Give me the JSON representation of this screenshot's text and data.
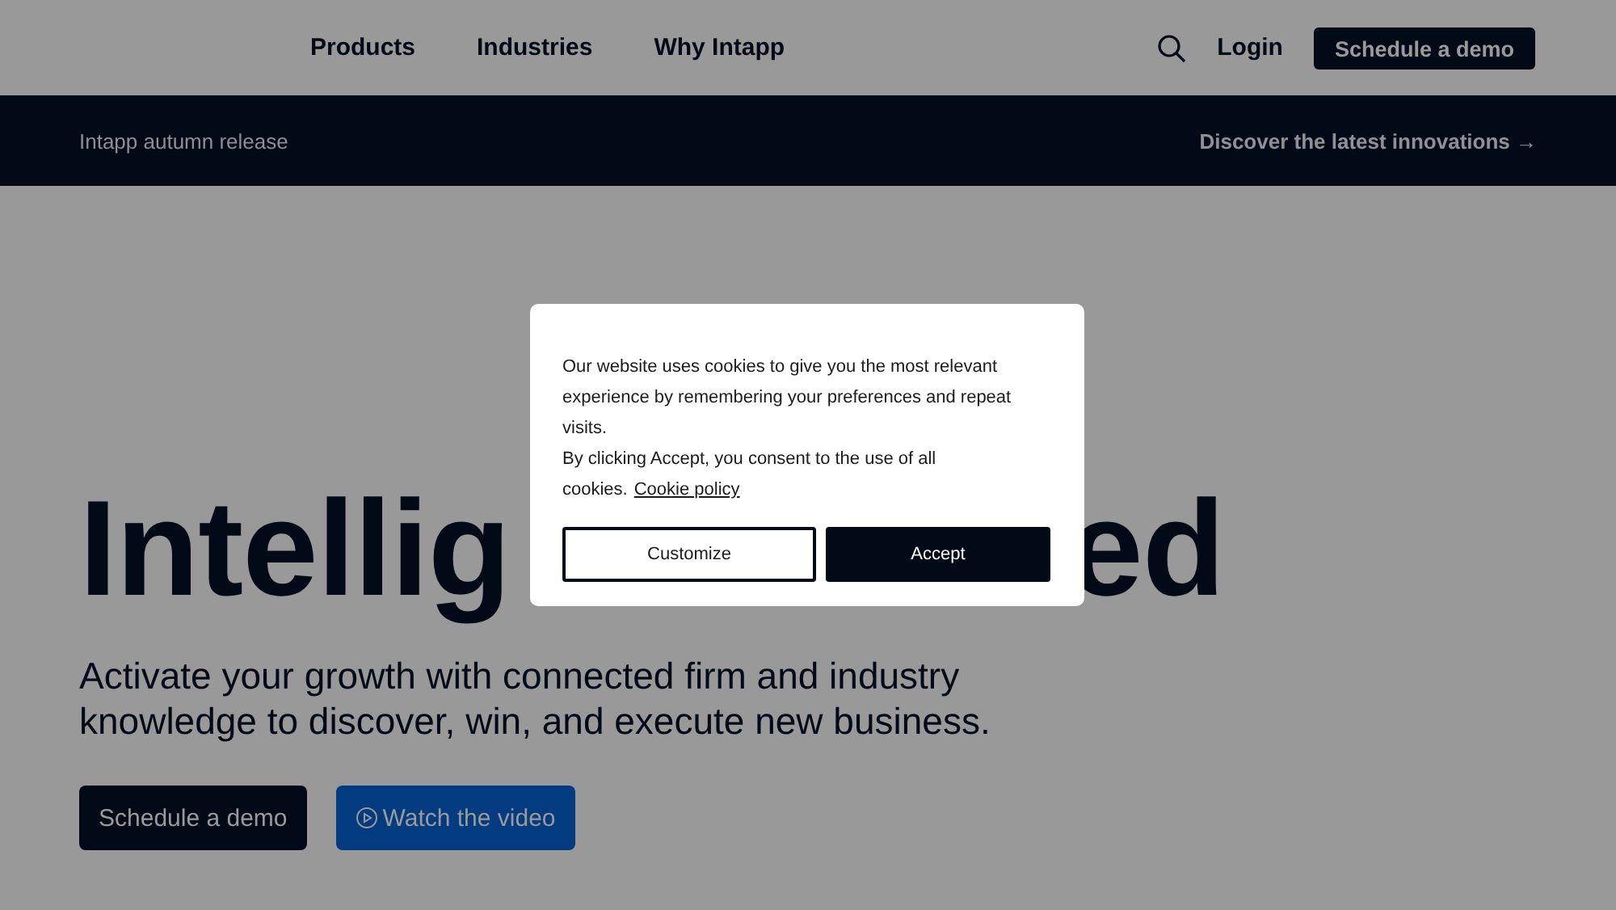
{
  "nav": {
    "links": [
      {
        "label": "Products"
      },
      {
        "label": "Industries"
      },
      {
        "label": "Why Intapp"
      }
    ],
    "login": "Login",
    "cta": "Schedule a demo"
  },
  "banner": {
    "text": "Intapp autumn release",
    "link": "Discover the latest innovations →"
  },
  "hero": {
    "headline_parts": [
      "Intellig",
      "ed"
    ],
    "subtitle": "Activate your growth with connected firm and industry knowledge to discover, win, and execute new business.",
    "primary_button": "Schedule a demo",
    "video_button": "Watch the video"
  },
  "cookie_dialog": {
    "message_lines": [
      "Our website uses cookies to give you the most relevant experience by remembering your preferences and repeat visits.",
      "By clicking Accept, you consent to the use of all cookies."
    ],
    "policy_link": "Cookie policy",
    "customize_button": "Customize",
    "accept_button": "Accept"
  }
}
